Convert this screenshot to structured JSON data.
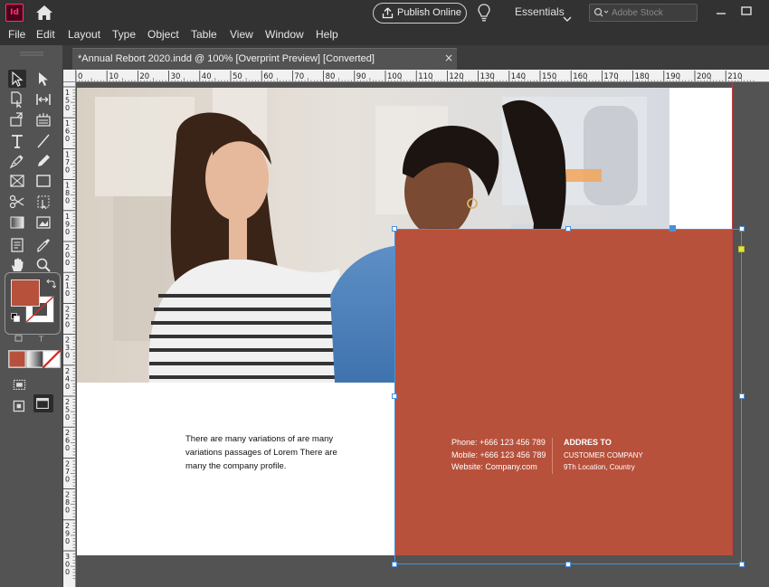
{
  "app": {
    "logo": "Id",
    "publish_label": "Publish Online",
    "workspace": "Essentials",
    "search_placeholder": "Adobe Stock"
  },
  "menu": [
    "File",
    "Edit",
    "Layout",
    "Type",
    "Object",
    "Table",
    "View",
    "Window",
    "Help"
  ],
  "document_tab": {
    "label": "*Annual Rebort 2020.indd @ 100%  [Overprint Preview] [Converted]",
    "close": "×"
  },
  "ruler": {
    "horizontal": [
      "0",
      "10",
      "20",
      "30",
      "40",
      "50",
      "60",
      "70",
      "80",
      "90",
      "100",
      "110",
      "120",
      "130",
      "140",
      "150",
      "160",
      "170",
      "180",
      "190",
      "200",
      "210"
    ],
    "vertical": [
      "150",
      "160",
      "170",
      "180",
      "190",
      "200",
      "210",
      "220",
      "230",
      "240",
      "250",
      "260",
      "270",
      "280",
      "290",
      "300"
    ]
  },
  "tools": [
    "selection-tool",
    "direct-selection-tool",
    "page-tool",
    "gap-tool",
    "content-collector-tool",
    "type-tool",
    "line-tool",
    "pen-tool",
    "pencil-tool",
    "rectangle-frame-tool",
    "rectangle-tool",
    "scissors-tool",
    "free-transform-tool",
    "gradient-swatch-tool",
    "gradient-feather-tool",
    "note-tool",
    "eyedropper-tool",
    "hand-tool",
    "zoom-tool"
  ],
  "colors": {
    "fill": "#b7513c",
    "stroke": "#ffffff",
    "accent_block": "#b7513c",
    "selection": "#4a90d9"
  },
  "page_content": {
    "body_text_lines": [
      "There are many variations of   are many",
      "variations passages of Lorem There are",
      "many the company profile."
    ],
    "contact": {
      "phone": "Phone: +666 123 456 789",
      "mobile": "Mobile: +666 123 456 789",
      "website": "Website: Company.com"
    },
    "address": {
      "heading": "ADDRES TO",
      "company": "CUSTOMER COMPANY",
      "location": "9Th Location, Country"
    }
  }
}
